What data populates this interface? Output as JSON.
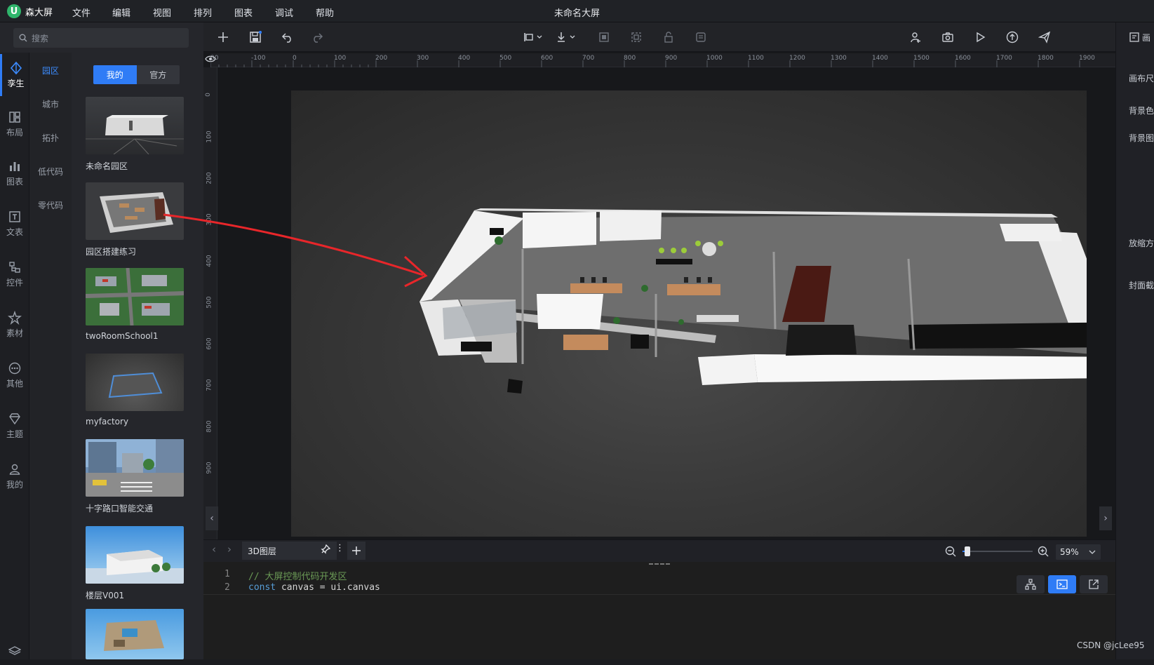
{
  "app": {
    "name": "森大屏",
    "logo_letter": "U",
    "title": "未命名大屏"
  },
  "menu": [
    "文件",
    "编辑",
    "视图",
    "排列",
    "图表",
    "调试",
    "帮助"
  ],
  "search": {
    "placeholder": "搜索"
  },
  "nav": [
    {
      "label": "孪生",
      "icon": "twin-icon",
      "active": true
    },
    {
      "label": "布局",
      "icon": "layout-icon"
    },
    {
      "label": "图表",
      "icon": "chart-icon"
    },
    {
      "label": "文表",
      "icon": "text-icon"
    },
    {
      "label": "控件",
      "icon": "control-icon"
    },
    {
      "label": "素材",
      "icon": "asset-icon"
    },
    {
      "label": "其他",
      "icon": "more-icon"
    },
    {
      "label": "主题",
      "icon": "theme-icon"
    },
    {
      "label": "我的",
      "icon": "user-icon"
    }
  ],
  "categories": [
    {
      "label": "园区",
      "active": true
    },
    {
      "label": "城市"
    },
    {
      "label": "拓扑"
    },
    {
      "label": "低代码"
    },
    {
      "label": "零代码"
    }
  ],
  "library_tabs": {
    "mine": "我的",
    "official": "官方"
  },
  "library_items": [
    "未命名园区",
    "园区搭建练习",
    "twoRoomSchool1",
    "myfactory",
    "十字路口智能交通",
    "楼层V001",
    ""
  ],
  "ruler": {
    "top": [
      "00",
      "-100",
      "0",
      "100",
      "200",
      "300",
      "400",
      "500",
      "600",
      "700",
      "800",
      "900",
      "1000",
      "1100",
      "1200",
      "1300",
      "1400",
      "1500",
      "1600",
      "1700",
      "1800",
      "1900"
    ],
    "left": [
      "0",
      "100",
      "200",
      "300",
      "400",
      "500",
      "600",
      "700",
      "800",
      "900"
    ]
  },
  "layer": {
    "name": "3D图层"
  },
  "zoom": {
    "value": "59%",
    "level": 0.05
  },
  "code": {
    "lines": [
      {
        "no": "1",
        "comment": "// 大屏控制代码开发区"
      },
      {
        "no": "2",
        "keyword": "const",
        "rest": " canvas = ui.canvas"
      }
    ]
  },
  "right_panel": [
    "画布尺",
    "背景色",
    "背景图",
    "放缩方",
    "封面截"
  ],
  "watermark": "CSDN @jcLee95",
  "colors": {
    "accent": "#2f7cf6",
    "logo_green": "#2fb56b",
    "arrow": "#e8262a"
  }
}
